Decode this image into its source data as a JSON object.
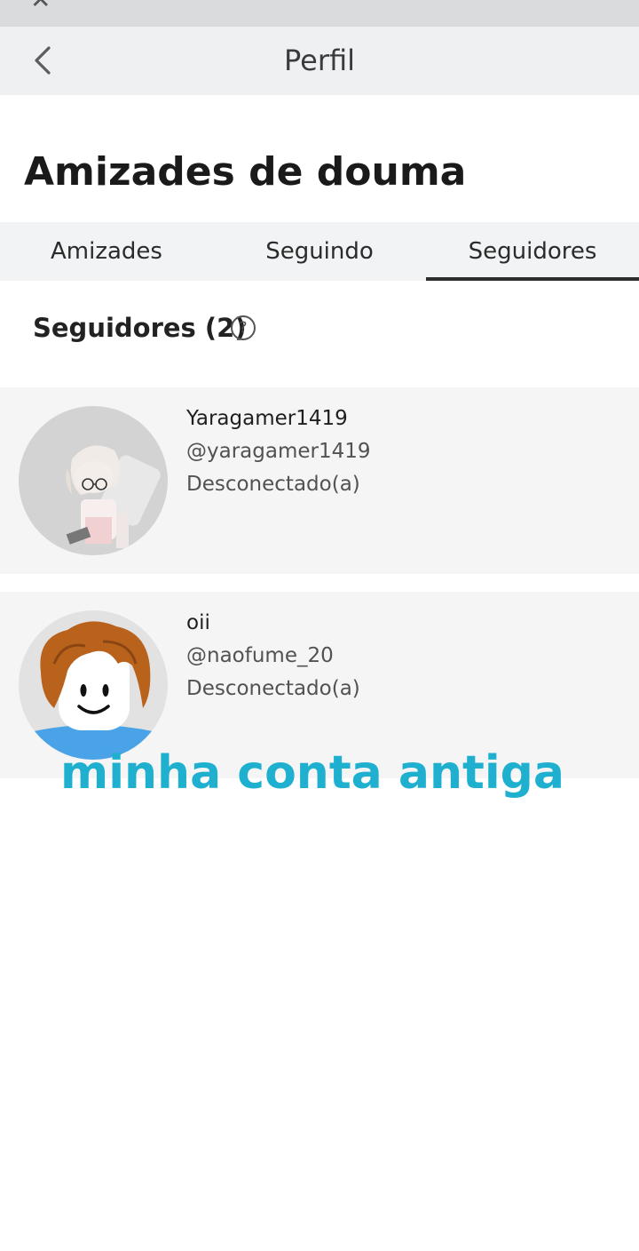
{
  "header": {
    "title": "Perfil"
  },
  "page": {
    "title": "Amizades de douma"
  },
  "tabs": [
    {
      "label": "Amizades",
      "active": false
    },
    {
      "label": "Seguindo",
      "active": false
    },
    {
      "label": "Seguidores",
      "active": true
    }
  ],
  "section": {
    "title": "Seguidores (2)",
    "help_icon": "?"
  },
  "followers": [
    {
      "display_name": "Yaragamer1419",
      "username": "@yaragamer1419",
      "status": "Desconectado(a)"
    },
    {
      "display_name": "oii",
      "username": "@naofume_20",
      "status": "Desconectado(a)"
    }
  ],
  "overlay_caption": "minha conta antiga",
  "colors": {
    "accent_caption": "#1fb0cf",
    "tab_indicator": "#2b2d2f",
    "row_bg": "#f5f5f6"
  }
}
